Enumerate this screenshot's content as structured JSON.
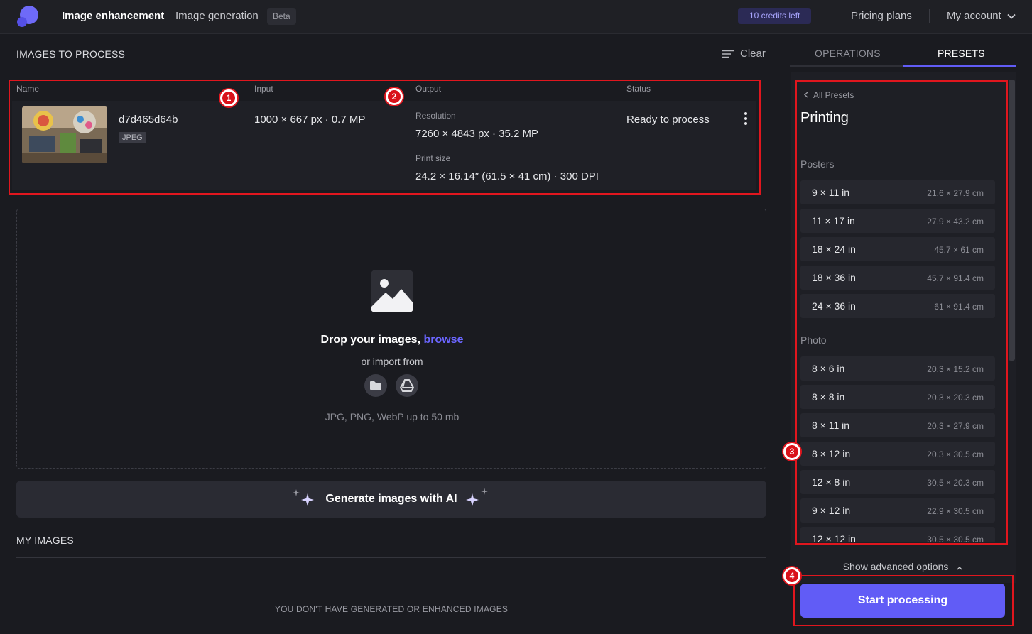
{
  "header": {
    "nav_enhance": "Image enhancement",
    "nav_generate": "Image generation",
    "beta_badge": "Beta",
    "credits": "10 credits left",
    "pricing": "Pricing plans",
    "account": "My account"
  },
  "process": {
    "title": "IMAGES TO PROCESS",
    "clear": "Clear",
    "columns": {
      "name": "Name",
      "input": "Input",
      "output": "Output",
      "status": "Status"
    },
    "row": {
      "filename": "d7d465d64b",
      "format": "JPEG",
      "input": "1000 × 667 px · 0.7 MP",
      "resolution_label": "Resolution",
      "resolution": "7260 × 4843 px · 35.2 MP",
      "print_label": "Print size",
      "print": "24.2 × 16.14″ (61.5 × 41 cm) · 300 DPI",
      "status": "Ready to process"
    }
  },
  "dropzone": {
    "title": "Drop your images, ",
    "browse": "browse",
    "import": "or import from",
    "hint": "JPG, PNG, WebP up to 50 mb"
  },
  "generate_label": "Generate images with AI",
  "my_images": {
    "title": "MY IMAGES",
    "empty": "YOU DON'T HAVE GENERATED OR ENHANCED IMAGES"
  },
  "panel": {
    "tabs": [
      "OPERATIONS",
      "PRESETS"
    ],
    "active_tab": "PRESETS",
    "back": "All Presets",
    "title": "Printing",
    "groups": [
      {
        "label": "Posters",
        "items": [
          {
            "name": "9 × 11 in",
            "cm": "21.6 × 27.9 cm"
          },
          {
            "name": "11 × 17 in",
            "cm": "27.9 × 43.2 cm"
          },
          {
            "name": "18 × 24 in",
            "cm": "45.7 × 61 cm"
          },
          {
            "name": "18 × 36 in",
            "cm": "45.7 × 91.4 cm"
          },
          {
            "name": "24 × 36 in",
            "cm": "61 × 91.4 cm"
          }
        ]
      },
      {
        "label": "Photo",
        "items": [
          {
            "name": "8 × 6 in",
            "cm": "20.3 × 15.2 cm"
          },
          {
            "name": "8 × 8 in",
            "cm": "20.3 × 20.3 cm"
          },
          {
            "name": "8 × 11 in",
            "cm": "20.3 × 27.9 cm"
          },
          {
            "name": "8 × 12 in",
            "cm": "20.3 × 30.5 cm"
          },
          {
            "name": "12 × 8 in",
            "cm": "30.5 × 20.3 cm"
          },
          {
            "name": "9 × 12 in",
            "cm": "22.9 × 30.5 cm"
          },
          {
            "name": "12 × 12 in",
            "cm": "30.5 × 30.5 cm"
          }
        ]
      }
    ],
    "advanced": "Show advanced options",
    "start": "Start processing"
  },
  "annotations": [
    "1",
    "2",
    "3",
    "4"
  ],
  "colors": {
    "accent": "#615cf6",
    "link": "#6b66ff",
    "annotation": "#e0161e",
    "background": "#1a1b20"
  }
}
